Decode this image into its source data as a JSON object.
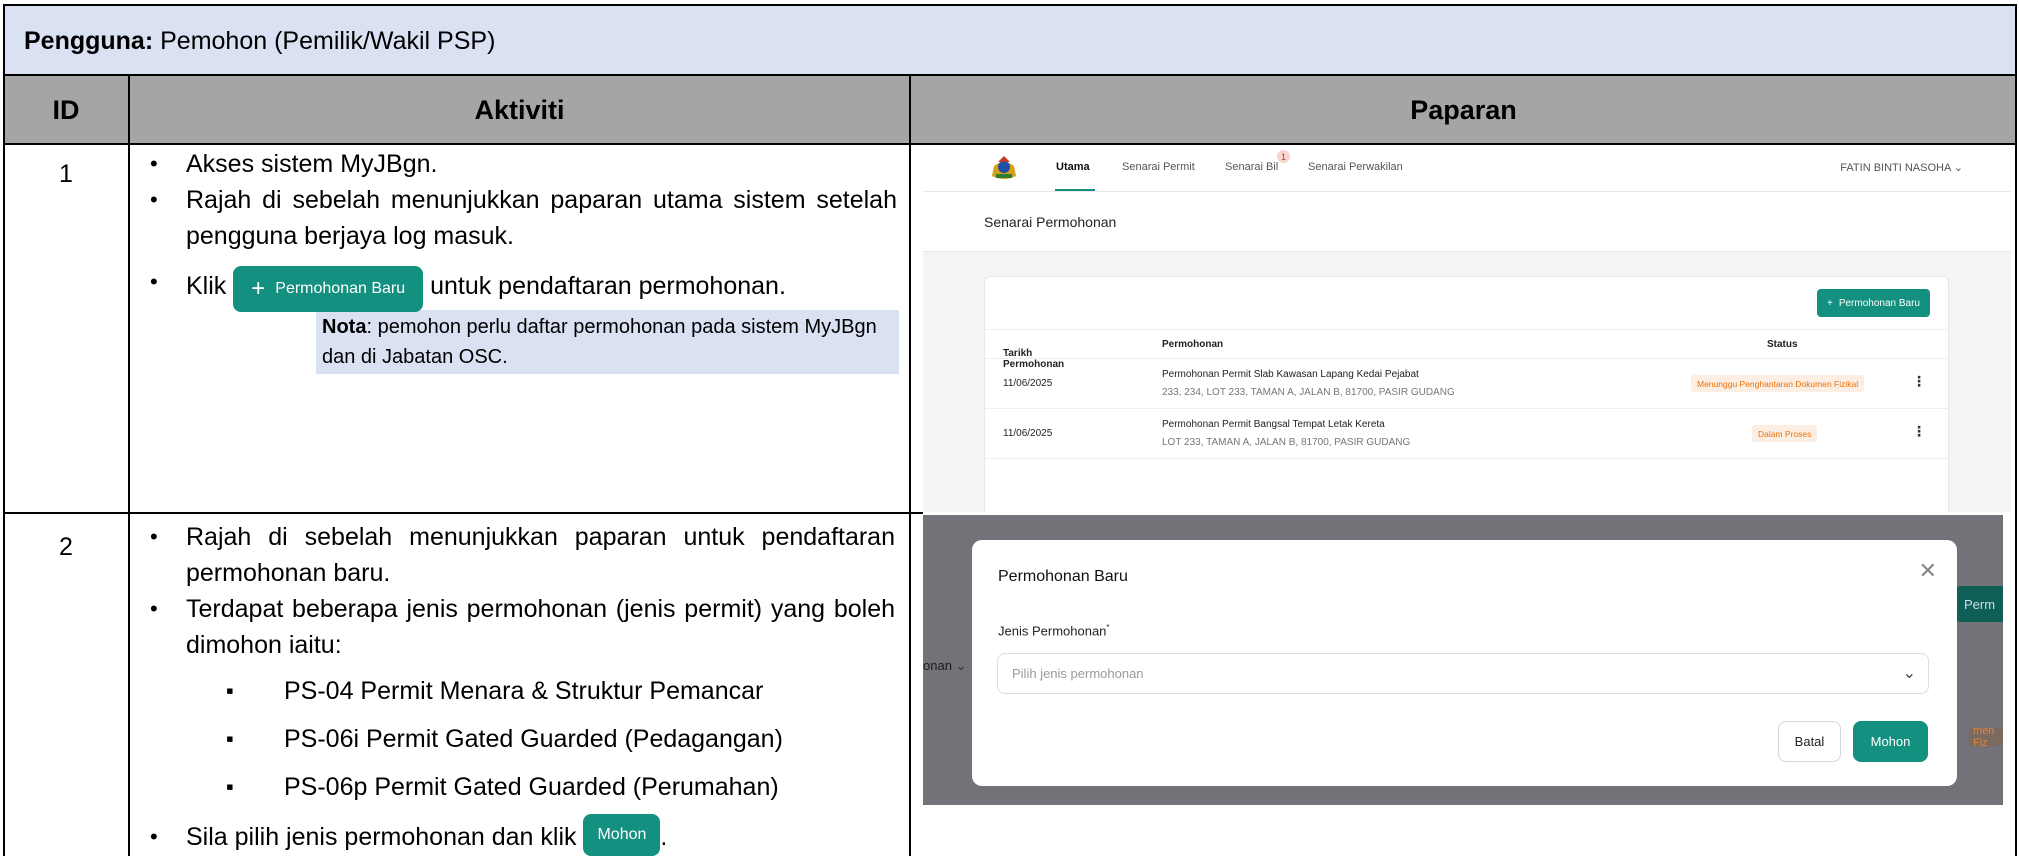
{
  "header": {
    "user_label": "Pengguna:",
    "user_value": "Pemohon (Pemilik/Wakil PSP)"
  },
  "columns": {
    "id": "ID",
    "activity": "Aktiviti",
    "display": "Paparan"
  },
  "row1": {
    "id": "1",
    "bullets": [
      "Akses sistem MyJBgn.",
      "Rajah di sebelah menunjukkan paparan utama sistem setelah pengguna berjaya log masuk."
    ],
    "klik": "Klik",
    "inline_button": "Permohonan Baru",
    "klik_suffix": "untuk pendaftaran permohonan.",
    "nota_label": "Nota",
    "nota_text": ": pemohon perlu daftar permohonan pada sistem MyJBgn dan di Jabatan OSC."
  },
  "row2": {
    "id": "2",
    "bullets": [
      "Rajah di sebelah menunjukkan paparan untuk pendaftaran permohonan baru.",
      "Terdapat beberapa jenis permohonan (jenis permit) yang boleh dimohon iaitu:"
    ],
    "permits": [
      "PS-04 Permit Menara & Struktur Pemancar",
      "PS-06i Permit Gated Guarded (Pedagangan)",
      "PS-06p Permit Gated Guarded (Perumahan)"
    ],
    "last_bullet": "Sila pilih jenis permohonan dan klik",
    "inline_button": "Mohon",
    "last_suffix": "."
  },
  "screen1": {
    "nav_tabs": [
      "Utama",
      "Senarai Permit",
      "Senarai Bil",
      "Senarai Perwakilan"
    ],
    "badge": "1",
    "user_name": "FATIN BINTI NASOHA",
    "page_title": "Senarai Permohonan",
    "new_button": "Permohonan Baru",
    "headers": [
      "Tarikh Permohonan",
      "Permohonan",
      "Status"
    ],
    "rows": [
      {
        "date": "11/06/2025",
        "title": "Permohonan Permit Slab Kawasan Lapang Kedai Pejabat",
        "address": "233, 234, LOT 233, TAMAN A, JALAN B, 81700, PASIR GUDANG",
        "status": "Menunggu Penghantaran Dokumen Fizikal"
      },
      {
        "date": "11/06/2025",
        "title": "Permohonan Permit Bangsal Tempat Letak Kereta",
        "address": "LOT 233, TAMAN A, JALAN B, 81700, PASIR GUDANG",
        "status": "Dalam Proses"
      }
    ]
  },
  "screen2": {
    "ghost_left": "onan",
    "ghost_button": "Perm",
    "ghost_badge": "men Fiz",
    "modal_title": "Permohonan Baru",
    "field_label": "Jenis Permohonan",
    "required_mark": "*",
    "placeholder": "Pilih jenis permohonan",
    "cancel": "Batal",
    "submit": "Mohon"
  },
  "colors": {
    "accent": "#13907f",
    "header_bg": "#d9e1f2",
    "column_header_bg": "#a5a5a5",
    "status_orange": "#e8720c"
  }
}
